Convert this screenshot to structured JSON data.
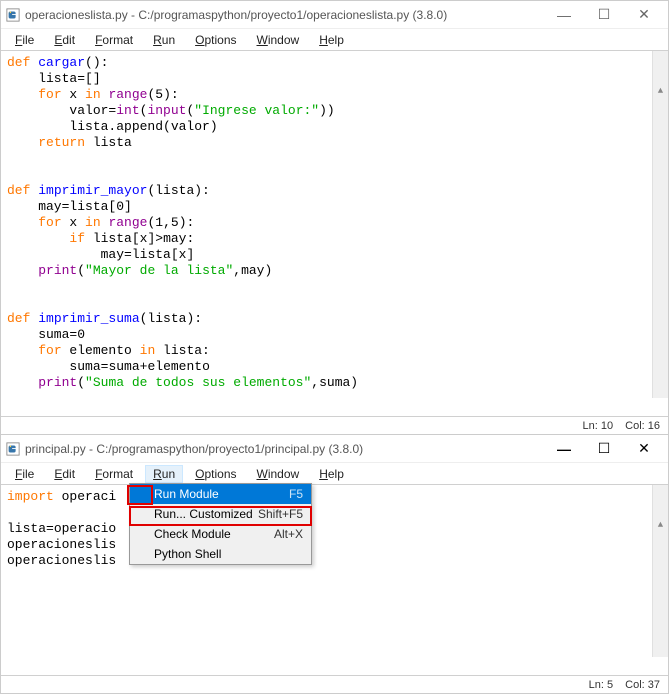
{
  "window_top": {
    "title": "operacioneslista.py - C:/programaspython/proyecto1/operacioneslista.py (3.8.0)",
    "menubar": [
      "File",
      "Edit",
      "Format",
      "Run",
      "Options",
      "Window",
      "Help"
    ],
    "status": {
      "ln": "Ln: 10",
      "col": "Col: 16"
    }
  },
  "code_top": {
    "lines": [
      [
        [
          "kw",
          "def "
        ],
        [
          "def-name",
          "cargar"
        ],
        [
          "txt",
          "():"
        ]
      ],
      [
        [
          "txt",
          "    lista"
        ],
        [
          "txt",
          "="
        ],
        [
          "txt",
          "[]"
        ]
      ],
      [
        [
          "txt",
          "    "
        ],
        [
          "kw",
          "for"
        ],
        [
          "txt",
          " x "
        ],
        [
          "kw",
          "in"
        ],
        [
          "txt",
          " "
        ],
        [
          "builtin",
          "range"
        ],
        [
          "txt",
          "("
        ],
        [
          "txt",
          "5"
        ],
        [
          "txt",
          "):"
        ]
      ],
      [
        [
          "txt",
          "        valor"
        ],
        [
          "txt",
          "="
        ],
        [
          "builtin",
          "int"
        ],
        [
          "txt",
          "("
        ],
        [
          "builtin",
          "input"
        ],
        [
          "txt",
          "("
        ],
        [
          "str",
          "\"Ingrese valor:\""
        ],
        [
          "txt",
          "))"
        ]
      ],
      [
        [
          "txt",
          "        lista.append(valor)"
        ]
      ],
      [
        [
          "txt",
          "    "
        ],
        [
          "kw",
          "return"
        ],
        [
          "txt",
          " lista"
        ]
      ],
      [
        [
          "txt",
          ""
        ]
      ],
      [
        [
          "txt",
          ""
        ]
      ],
      [
        [
          "kw",
          "def "
        ],
        [
          "def-name",
          "imprimir_mayor"
        ],
        [
          "txt",
          "(lista):"
        ]
      ],
      [
        [
          "txt",
          "    may"
        ],
        [
          "txt",
          "="
        ],
        [
          "txt",
          "lista["
        ],
        [
          "txt",
          "0"
        ],
        [
          "txt",
          "]"
        ]
      ],
      [
        [
          "txt",
          "    "
        ],
        [
          "kw",
          "for"
        ],
        [
          "txt",
          " x "
        ],
        [
          "kw",
          "in"
        ],
        [
          "txt",
          " "
        ],
        [
          "builtin",
          "range"
        ],
        [
          "txt",
          "("
        ],
        [
          "txt",
          "1"
        ],
        [
          "txt",
          ","
        ],
        [
          "txt",
          "5"
        ],
        [
          "txt",
          "):"
        ]
      ],
      [
        [
          "txt",
          "        "
        ],
        [
          "kw",
          "if"
        ],
        [
          "txt",
          " lista[x]"
        ],
        [
          "txt",
          ">"
        ],
        [
          "txt",
          "may:"
        ]
      ],
      [
        [
          "txt",
          "            may"
        ],
        [
          "txt",
          "="
        ],
        [
          "txt",
          "lista[x]"
        ]
      ],
      [
        [
          "txt",
          "    "
        ],
        [
          "builtin",
          "print"
        ],
        [
          "txt",
          "("
        ],
        [
          "str",
          "\"Mayor de la lista\""
        ],
        [
          "txt",
          ",may)"
        ]
      ],
      [
        [
          "txt",
          ""
        ]
      ],
      [
        [
          "txt",
          ""
        ]
      ],
      [
        [
          "kw",
          "def "
        ],
        [
          "def-name",
          "imprimir_suma"
        ],
        [
          "txt",
          "(lista):"
        ]
      ],
      [
        [
          "txt",
          "    suma"
        ],
        [
          "txt",
          "="
        ],
        [
          "txt",
          "0"
        ]
      ],
      [
        [
          "txt",
          "    "
        ],
        [
          "kw",
          "for"
        ],
        [
          "txt",
          " elemento "
        ],
        [
          "kw",
          "in"
        ],
        [
          "txt",
          " lista:"
        ]
      ],
      [
        [
          "txt",
          "        suma"
        ],
        [
          "txt",
          "="
        ],
        [
          "txt",
          "suma"
        ],
        [
          "txt",
          "+"
        ],
        [
          "txt",
          "elemento"
        ]
      ],
      [
        [
          "txt",
          "    "
        ],
        [
          "builtin",
          "print"
        ],
        [
          "txt",
          "("
        ],
        [
          "str",
          "\"Suma de todos sus elementos\""
        ],
        [
          "txt",
          ",suma)"
        ]
      ]
    ]
  },
  "window_bottom": {
    "title": "principal.py - C:/programaspython/proyecto1/principal.py (3.8.0)",
    "menubar": [
      "File",
      "Edit",
      "Format",
      "Run",
      "Options",
      "Window",
      "Help"
    ],
    "status": {
      "ln": "Ln: 5",
      "col": "Col: 37"
    },
    "dropdown": {
      "items": [
        {
          "label": "Run Module",
          "accel": "F5",
          "selected": true
        },
        {
          "label": "Run... Customized",
          "accel": "Shift+F5",
          "selected": false
        },
        {
          "label": "Check Module",
          "accel": "Alt+X",
          "selected": false
        },
        {
          "label": "Python Shell",
          "accel": "",
          "selected": false
        }
      ]
    }
  },
  "code_bottom": {
    "lines": [
      [
        [
          "kw",
          "import"
        ],
        [
          "txt",
          " operaci"
        ]
      ],
      [
        [
          "txt",
          ""
        ]
      ],
      [
        [
          "txt",
          "lista"
        ],
        [
          "txt",
          "="
        ],
        [
          "txt",
          "operacio"
        ]
      ],
      [
        [
          "txt",
          "operacioneslis"
        ]
      ],
      [
        [
          "txt",
          "operacioneslis"
        ]
      ]
    ]
  }
}
